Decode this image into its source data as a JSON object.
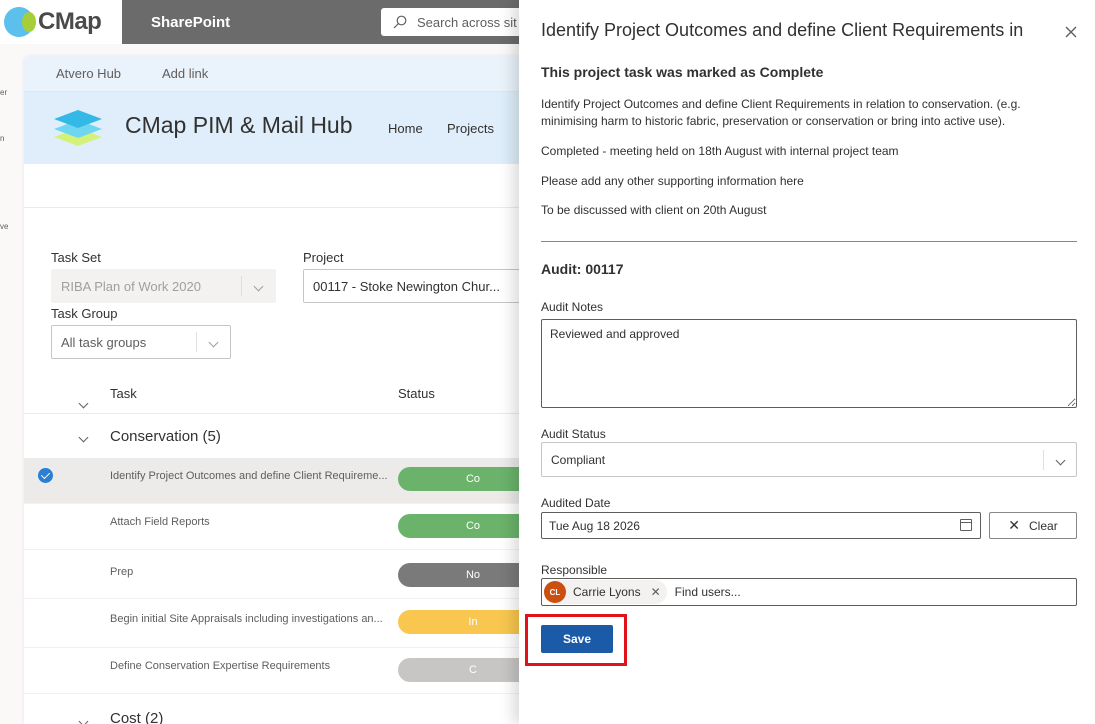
{
  "suite": {
    "brand": "CMap",
    "app": "SharePoint",
    "search_placeholder": "Search across site"
  },
  "left_fragments": [
    "er",
    "n",
    "ve"
  ],
  "site": {
    "hub_links": [
      "Atvero Hub",
      "Add link"
    ],
    "title": "CMap PIM & Mail Hub",
    "nav": [
      "Home",
      "Projects"
    ]
  },
  "filters": {
    "task_set_label": "Task Set",
    "task_set_value": "RIBA Plan of Work 2020",
    "project_label": "Project",
    "project_value": "00117 - Stoke Newington Chur...",
    "task_group_label": "Task Group",
    "task_group_value": "All task groups"
  },
  "table": {
    "col_task": "Task",
    "col_status": "Status",
    "groups": [
      {
        "label": "Conservation (5)"
      },
      {
        "label": "Cost (2)"
      }
    ],
    "rows": [
      {
        "name": "Identify Project Outcomes and define Client Requireme...",
        "status_fragment": "Co",
        "color": "#6bb36b",
        "selected": true
      },
      {
        "name": "Attach Field Reports",
        "status_fragment": "Co",
        "color": "#6bb36b",
        "selected": false
      },
      {
        "name": "Prep",
        "status_fragment": "No",
        "color": "#7a7a7a",
        "selected": false
      },
      {
        "name": "Begin initial Site Appraisals including investigations an...",
        "status_fragment": "In",
        "color": "#f9c74f",
        "selected": false
      },
      {
        "name": "Define Conservation Expertise Requirements",
        "status_fragment": "C",
        "color": "#c8c6c4",
        "selected": false
      }
    ]
  },
  "panel": {
    "title": "Identify Project Outcomes and define Client Requirements in",
    "status_heading": "This project task was marked as Complete",
    "description": "Identify Project Outcomes and define Client Requirements in relation to conservation. (e.g. minimising harm to historic fabric, preservation or conservation or bring into active use).",
    "note1": "Completed - meeting held on 18th August with internal project team",
    "note2": "Please add any other supporting information here",
    "note3": "To be discussed with client on 20th August",
    "audit_heading": "Audit: 00117",
    "audit_notes_label": "Audit Notes",
    "audit_notes_value": "Reviewed and approved",
    "audit_status_label": "Audit Status",
    "audit_status_value": "Compliant",
    "audited_date_label": "Audited Date",
    "audited_date_value": "Tue Aug 18 2026",
    "clear_label": "Clear",
    "responsible_label": "Responsible",
    "responsible_initials": "CL",
    "responsible_name": "Carrie Lyons",
    "find_users_placeholder": "Find users...",
    "save_label": "Save"
  }
}
